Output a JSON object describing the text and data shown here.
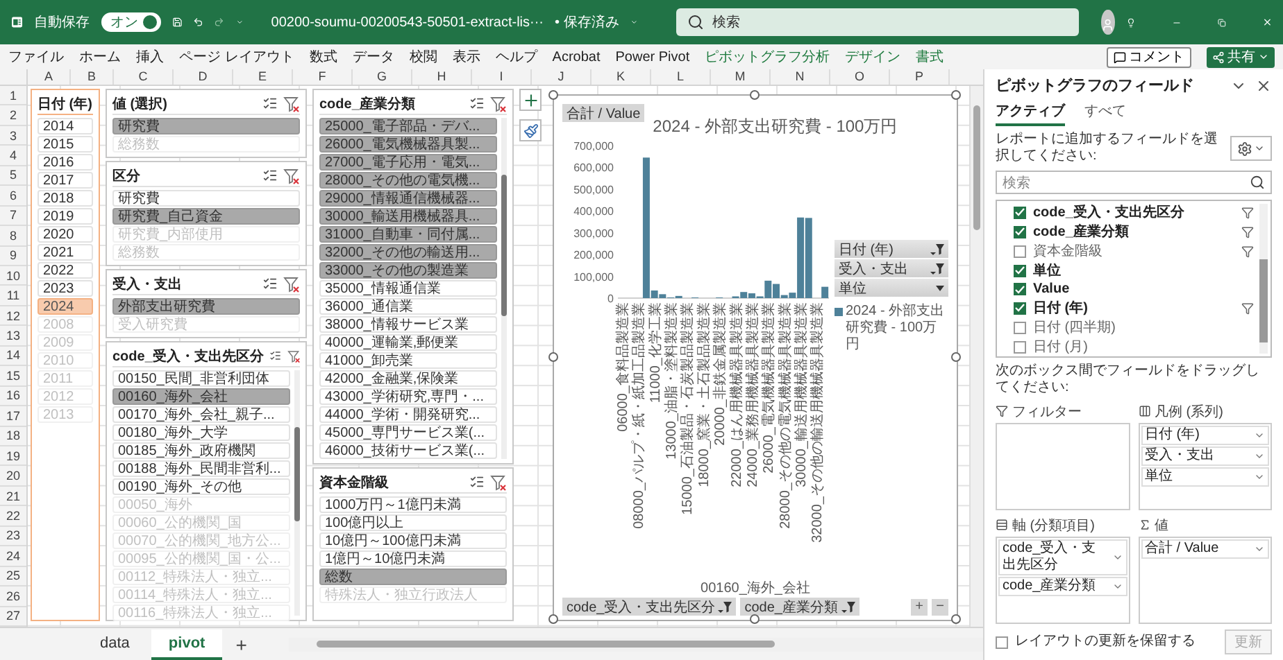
{
  "title_bar": {
    "autosave_label": "自動保存",
    "autosave_toggle": {
      "label": "オン",
      "on": true
    },
    "filename": "00200-soumu-00200543-50501-extract-lis···",
    "save_status": "• 保存済み",
    "search": {
      "placeholder": "検索"
    }
  },
  "ribbon_tabs": [
    {
      "label": "ファイル",
      "kind": "normal"
    },
    {
      "label": "ホーム",
      "kind": "normal"
    },
    {
      "label": "挿入",
      "kind": "normal"
    },
    {
      "label": "ページ レイアウト",
      "kind": "normal"
    },
    {
      "label": "数式",
      "kind": "normal"
    },
    {
      "label": "データ",
      "kind": "normal"
    },
    {
      "label": "校閲",
      "kind": "normal"
    },
    {
      "label": "表示",
      "kind": "normal"
    },
    {
      "label": "ヘルプ",
      "kind": "normal"
    },
    {
      "label": "Acrobat",
      "kind": "normal"
    },
    {
      "label": "Power Pivot",
      "kind": "normal"
    },
    {
      "label": "ピボットグラフ分析",
      "kind": "contextual"
    },
    {
      "label": "デザイン",
      "kind": "contextual"
    },
    {
      "label": "書式",
      "kind": "contextual"
    }
  ],
  "ribbon_buttons": {
    "comment": "コメント",
    "share": "共有"
  },
  "columns": [
    "A",
    "B",
    "C",
    "D",
    "E",
    "F",
    "G",
    "H",
    "I",
    "J",
    "K",
    "L",
    "M",
    "N",
    "O",
    "P"
  ],
  "rows": [
    "1",
    "2",
    "3",
    "4",
    "5",
    "6",
    "7",
    "8",
    "9",
    "10",
    "11",
    "12",
    "13",
    "14",
    "15",
    "16",
    "17",
    "18",
    "19",
    "20",
    "21",
    "22",
    "23",
    "24",
    "25",
    "26",
    "27"
  ],
  "slicer_columns": [
    [
      {
        "title": "日付 (年)",
        "kind": "accent",
        "items": [
          {
            "label": "2014",
            "selected": false,
            "disabled": false
          },
          {
            "label": "2015",
            "selected": false,
            "disabled": false
          },
          {
            "label": "2016",
            "selected": false,
            "disabled": false
          },
          {
            "label": "2017",
            "selected": false,
            "disabled": false
          },
          {
            "label": "2018",
            "selected": false,
            "disabled": false
          },
          {
            "label": "2019",
            "selected": false,
            "disabled": false
          },
          {
            "label": "2020",
            "selected": false,
            "disabled": false
          },
          {
            "label": "2021",
            "selected": false,
            "disabled": false
          },
          {
            "label": "2022",
            "selected": false,
            "disabled": false
          },
          {
            "label": "2023",
            "selected": false,
            "disabled": false
          },
          {
            "label": "2024",
            "selected": true,
            "disabled": false
          },
          {
            "label": "2008",
            "selected": false,
            "disabled": true
          },
          {
            "label": "2009",
            "selected": false,
            "disabled": true
          },
          {
            "label": "2010",
            "selected": false,
            "disabled": true
          },
          {
            "label": "2011",
            "selected": false,
            "disabled": true
          },
          {
            "label": "2012",
            "selected": false,
            "disabled": true
          },
          {
            "label": "2013",
            "selected": false,
            "disabled": true
          }
        ]
      }
    ],
    [
      {
        "title": "値 (選択)",
        "kind": "plain",
        "items": [
          {
            "label": "研究費",
            "selected": true,
            "disabled": false
          },
          {
            "label": "総務数",
            "selected": false,
            "disabled": true
          }
        ]
      },
      {
        "title": "区分",
        "kind": "plain",
        "items": [
          {
            "label": "研究費",
            "selected": false,
            "disabled": false
          },
          {
            "label": "研究費_自己資金",
            "selected": true,
            "disabled": false
          },
          {
            "label": "研究費_内部使用",
            "selected": false,
            "disabled": true
          },
          {
            "label": "総務数",
            "selected": false,
            "disabled": true
          }
        ]
      },
      {
        "title": "受入・支出",
        "kind": "plain",
        "items": [
          {
            "label": "外部支出研究費",
            "selected": true,
            "disabled": false
          },
          {
            "label": "受入研究費",
            "selected": false,
            "disabled": true
          }
        ]
      },
      {
        "title": "code_受入・支出先区分",
        "kind": "plain",
        "items": [
          {
            "label": "00150_民間_非営利団体",
            "selected": false,
            "disabled": false
          },
          {
            "label": "00160_海外_会社",
            "selected": true,
            "disabled": false
          },
          {
            "label": "00170_海外_会社_親子...",
            "selected": false,
            "disabled": false
          },
          {
            "label": "00180_海外_大学",
            "selected": false,
            "disabled": false
          },
          {
            "label": "00185_海外_政府機関",
            "selected": false,
            "disabled": false
          },
          {
            "label": "00188_海外_民間非営利...",
            "selected": false,
            "disabled": false
          },
          {
            "label": "00190_海外_その他",
            "selected": false,
            "disabled": false
          },
          {
            "label": "00050_海外",
            "selected": false,
            "disabled": true
          },
          {
            "label": "00060_公的機関_国",
            "selected": false,
            "disabled": true
          },
          {
            "label": "00070_公的機関_地方公...",
            "selected": false,
            "disabled": true
          },
          {
            "label": "00095_公的機関_国・公...",
            "selected": false,
            "disabled": true
          },
          {
            "label": "00112_特殊法人・独立...",
            "selected": false,
            "disabled": true
          },
          {
            "label": "00114_特殊法人・独立...",
            "selected": false,
            "disabled": true
          },
          {
            "label": "00116_特殊法人・独立...",
            "selected": false,
            "disabled": true
          }
        ]
      }
    ],
    [
      {
        "title": "code_産業分類",
        "kind": "plain",
        "items": [
          {
            "label": "25000_電子部品・デバ...",
            "selected": true,
            "disabled": false
          },
          {
            "label": "26000_電気機械器具製...",
            "selected": true,
            "disabled": false
          },
          {
            "label": "27000_電子応用・電気...",
            "selected": true,
            "disabled": false
          },
          {
            "label": "28000_その他の電気機...",
            "selected": true,
            "disabled": false
          },
          {
            "label": "29000_情報通信機械器...",
            "selected": true,
            "disabled": false
          },
          {
            "label": "30000_輸送用機械器具...",
            "selected": true,
            "disabled": false
          },
          {
            "label": "31000_自動車・同付属...",
            "selected": true,
            "disabled": false
          },
          {
            "label": "32000_その他の輸送用...",
            "selected": true,
            "disabled": false
          },
          {
            "label": "33000_その他の製造業",
            "selected": true,
            "disabled": false
          },
          {
            "label": "35000_情報通信業",
            "selected": false,
            "disabled": false
          },
          {
            "label": "36000_通信業",
            "selected": false,
            "disabled": false
          },
          {
            "label": "38000_情報サービス業",
            "selected": false,
            "disabled": false
          },
          {
            "label": "40000_運輸業,郵便業",
            "selected": false,
            "disabled": false
          },
          {
            "label": "41000_卸売業",
            "selected": false,
            "disabled": false
          },
          {
            "label": "42000_金融業,保険業",
            "selected": false,
            "disabled": false
          },
          {
            "label": "43000_学術研究,専門・...",
            "selected": false,
            "disabled": false
          },
          {
            "label": "44000_学術・開発研究...",
            "selected": false,
            "disabled": false
          },
          {
            "label": "45000_専門サービス業(...",
            "selected": false,
            "disabled": false
          },
          {
            "label": "46000_技術サービス業(...",
            "selected": false,
            "disabled": false
          }
        ]
      },
      {
        "title": "資本金階級",
        "kind": "plain",
        "items": [
          {
            "label": "1000万円～1億円未満",
            "selected": false,
            "disabled": false
          },
          {
            "label": "100億円以上",
            "selected": false,
            "disabled": false
          },
          {
            "label": "10億円～100億円未満",
            "selected": false,
            "disabled": false
          },
          {
            "label": "1億円～10億円未満",
            "selected": false,
            "disabled": false
          },
          {
            "label": "総数",
            "selected": true,
            "disabled": false
          },
          {
            "label": "特殊法人・独立行政法人",
            "selected": false,
            "disabled": true
          }
        ]
      }
    ]
  ],
  "chart": {
    "value_button": "合計 / Value",
    "chart_data": {
      "type": "bar",
      "title": "2024 - 外部支出研究費 - 100万円",
      "xlabel": "00160_海外_会社",
      "categories": [
        "06000_食料品製造業",
        null,
        "08000_パルプ・紙・紙加工品製造業",
        null,
        "11000_化学工業",
        null,
        "13000_油脂・塗料製造業",
        null,
        "15000_石油製品・石炭製品製造業",
        null,
        "18000_窯業・土石製品製造業",
        null,
        "20000_非鉄金属製造業",
        null,
        "22000_はん用機械器具製造業",
        null,
        "24000_業務用機械器具製造業",
        null,
        "26000_電気機械器具製造業",
        null,
        "28000_その他の電気機械器具製造業",
        null,
        "30000_輸送用機械器具製造業",
        null,
        "32000_その他の輸送用機械器具製造業",
        null
      ],
      "series": [
        {
          "name": "2024 - 外部支出研究費 - 100万円",
          "color": "#4e8199",
          "values": [
            null,
            null,
            null,
            645000,
            35000,
            18000,
            3000,
            10000,
            null,
            3000,
            null,
            null,
            3000,
            null,
            8000,
            28000,
            22000,
            8000,
            80000,
            65000,
            14000,
            25000,
            370000,
            368000,
            null,
            52000
          ]
        }
      ],
      "ylim": [
        0,
        700000
      ],
      "yticks": [
        {
          "value": 0,
          "label": "0"
        },
        {
          "value": 100000,
          "label": "100,000"
        },
        {
          "value": 200000,
          "label": "200,000"
        },
        {
          "value": 300000,
          "label": "300,000"
        },
        {
          "value": 400000,
          "label": "400,000"
        },
        {
          "value": 500000,
          "label": "500,000"
        },
        {
          "value": 600000,
          "label": "600,000"
        },
        {
          "value": 700000,
          "label": "700,000"
        }
      ]
    },
    "legend_buttons": [
      {
        "label": "日付 (年)",
        "filtered": true
      },
      {
        "label": "受入・支出",
        "filtered": true
      },
      {
        "label": "単位",
        "filtered": false
      }
    ],
    "axis_buttons": [
      {
        "label": "code_受入・支出先区分",
        "filtered": true
      },
      {
        "label": "code_産業分類",
        "filtered": true
      }
    ],
    "zoom_buttons": [
      "+",
      "−"
    ]
  },
  "sheet_tabs": [
    {
      "label": "data",
      "selected": false
    },
    {
      "label": "pivot",
      "selected": true
    }
  ],
  "add_sheet": "+",
  "field_pane": {
    "title": "ピボットグラフのフィールド",
    "tabs": [
      {
        "label": "アクティブ",
        "selected": true
      },
      {
        "label": "すべて",
        "selected": false
      }
    ],
    "instruction": "レポートに追加するフィールドを選択してください:",
    "search": {
      "placeholder": "検索"
    },
    "fields": [
      {
        "label": "code_受入・支出先区分",
        "checked": true,
        "filtered": true
      },
      {
        "label": "code_産業分類",
        "checked": true,
        "filtered": true
      },
      {
        "label": "資本金階級",
        "checked": false,
        "filtered": true
      },
      {
        "label": "単位",
        "checked": true,
        "filtered": false
      },
      {
        "label": "Value",
        "checked": true,
        "filtered": false
      },
      {
        "label": "日付 (年)",
        "checked": true,
        "filtered": true
      },
      {
        "label": "日付 (四半期)",
        "checked": false,
        "filtered": false
      },
      {
        "label": "日付 (月)",
        "checked": false,
        "filtered": false
      }
    ],
    "drag_instruction": "次のボックス間でフィールドをドラッグしてください:",
    "areas": [
      {
        "title": "フィルター",
        "kind": "filter"
      },
      {
        "title": "凡例 (系列)",
        "kind": "legend",
        "items": [
          "日付 (年)",
          "受入・支出",
          "単位"
        ]
      },
      {
        "title": "軸 (分類項目)",
        "kind": "axis",
        "items": [
          "code_受入・支出先区分",
          "code_産業分類"
        ]
      },
      {
        "title": "値",
        "kind": "values",
        "items": [
          "合計 / Value"
        ]
      }
    ],
    "defer": {
      "label": "レイアウトの更新を保留する",
      "checked": false
    },
    "update_button": {
      "label": "更新",
      "disabled": true
    }
  }
}
